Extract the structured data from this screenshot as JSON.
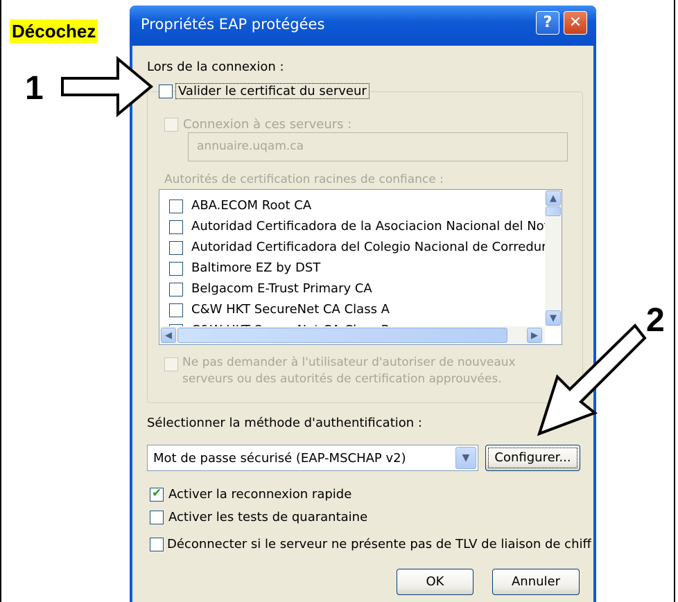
{
  "annotations": {
    "instruction": "Décochez",
    "step1": "1",
    "step2": "2"
  },
  "dialog": {
    "title": "Propriétés EAP protégées",
    "titlebar_buttons": [
      {
        "glyph": "?",
        "icon": "help-icon"
      },
      {
        "glyph": "✕",
        "icon": "close-icon"
      }
    ]
  },
  "form": {
    "auth_method_label": "Sélectionner la méthode d'authentification :",
    "auth_method_value": "Mot de passe sécurisé (EAP-MSCHAP v2)",
    "buttons": {
      "cancel": "Annuler",
      "configure": "Configurer...",
      "ok": "OK"
    },
    "ca_list": [
      "ABA.ECOM Root CA",
      "Autoridad Certificadora de la Asociacion Nacional del Notaria",
      "Autoridad Certificadora del Colegio Nacional de Correduria P",
      "Baltimore EZ by DST",
      "Belgacom E-Trust Primary CA",
      "C&W HKT SecureNet CA Class A",
      "C&W HKT SecureNet CA Class B"
    ],
    "ca_list_label": "Autorités de certification racines de confiance :",
    "connect_servers_label": "Connexion à ces serveurs :",
    "disconnect_tlv_label": "Déconnecter si le serveur ne présente pas de TLV de liaison de chiffremen",
    "fast_reconnect_checked": true,
    "fast_reconnect_label": "Activer la reconnexion rapide",
    "lors_label": "Lors de la connexion :",
    "no_prompt_line1": "Ne pas demander à l'utilisateur d'autoriser de nouveaux",
    "no_prompt_line2": "serveurs ou des autorités de certification approuvées.",
    "quarantine_label": "Activer les tests de quarantaine",
    "server_name_value": "annuaire.uqam.ca",
    "validate_cert_checked": false,
    "validate_cert_label": "Valider le certificat du serveur"
  }
}
